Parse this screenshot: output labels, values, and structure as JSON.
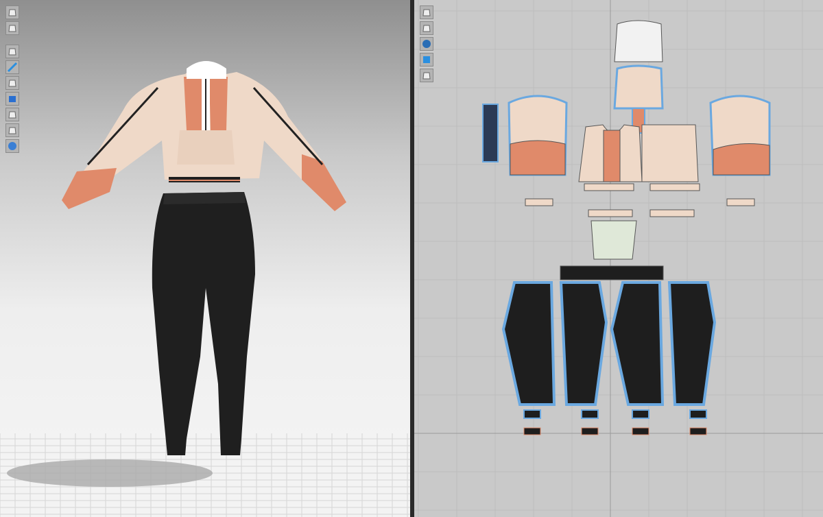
{
  "viewport_3d": {
    "toolbar": [
      {
        "icon": "simulation-icon"
      },
      {
        "icon": "garment-icon"
      },
      {
        "icon": "show-garment-icon"
      },
      {
        "icon": "show-texture-icon"
      },
      {
        "icon": "show-avatar-icon"
      },
      {
        "icon": "render-mode-icon"
      },
      {
        "icon": "shading-icon"
      },
      {
        "icon": "avatar-visibility-icon"
      },
      {
        "icon": "environment-icon"
      }
    ]
  },
  "viewport_2d": {
    "toolbar": [
      {
        "icon": "show-seam-icon"
      },
      {
        "icon": "show-pattern-icon"
      },
      {
        "icon": "info-icon"
      },
      {
        "icon": "texture-2d-icon"
      },
      {
        "icon": "lock-pattern-icon"
      }
    ]
  },
  "colors": {
    "hoodie_body": "#efd9c8",
    "hoodie_accent": "#e08a6a",
    "pants": "#1e1e1e",
    "pattern_outline": "#6aa8e0",
    "pattern_bg": "#c9c9c9"
  }
}
